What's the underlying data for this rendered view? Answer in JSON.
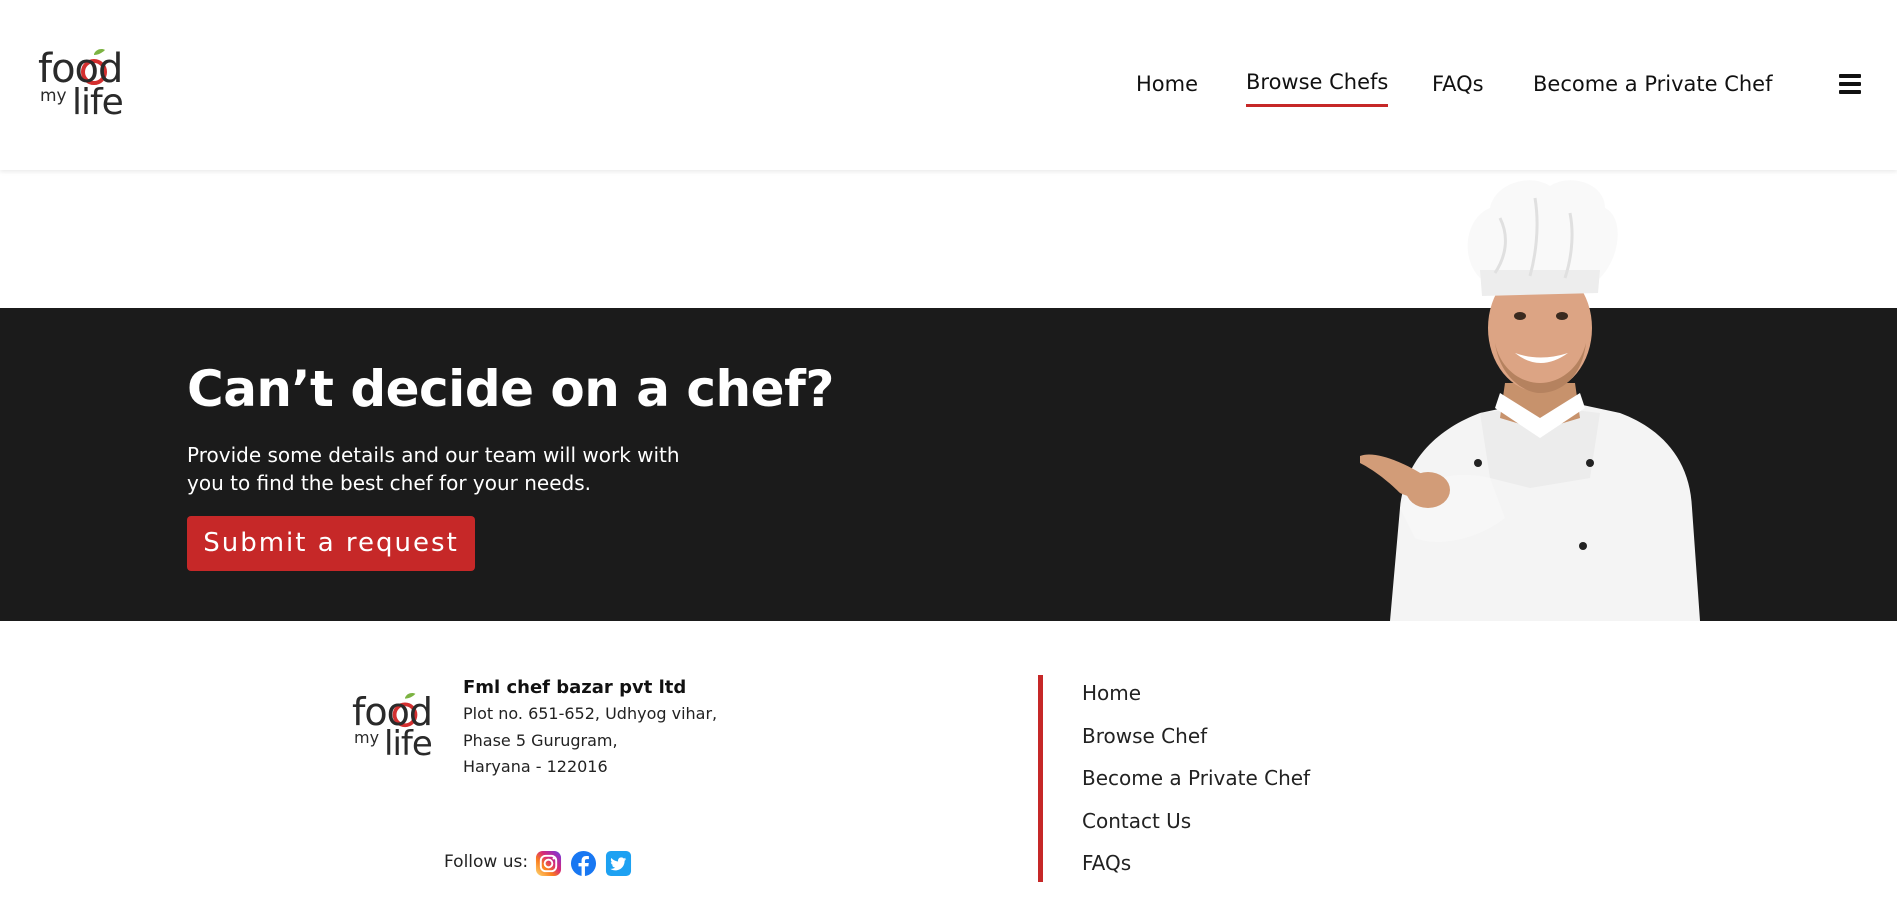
{
  "brand": {
    "logo_food": "food",
    "logo_my": "my",
    "logo_life": "life",
    "accent_color": "#c62828",
    "band_color": "#1b1b1b"
  },
  "nav": {
    "items": [
      {
        "label": "Home",
        "active": false
      },
      {
        "label": "Browse Chefs",
        "active": true
      },
      {
        "label": "FAQs",
        "active": false
      },
      {
        "label": "Become a Private Chef",
        "active": false
      }
    ],
    "menu_icon": "hamburger-menu-icon"
  },
  "hero": {
    "title": "Can’t decide on a chef?",
    "desc_line1": "Provide some details and our team will work with",
    "desc_line2": "you to find the best chef for your needs.",
    "cta_label": "Submit a request",
    "image": "smiling-chef-pointing"
  },
  "footer": {
    "company_name": "Fml chef bazar pvt ltd",
    "address": [
      "Plot no. 651-652, Udhyog vihar,",
      "Phase 5 Gurugram,",
      "Haryana - 122016"
    ],
    "follow_label": "Follow us:",
    "social": [
      "instagram-icon",
      "facebook-icon",
      "twitter-icon"
    ],
    "links": [
      "Home",
      "Browse Chef",
      "Become a Private Chef",
      "Contact Us",
      "FAQs"
    ]
  }
}
